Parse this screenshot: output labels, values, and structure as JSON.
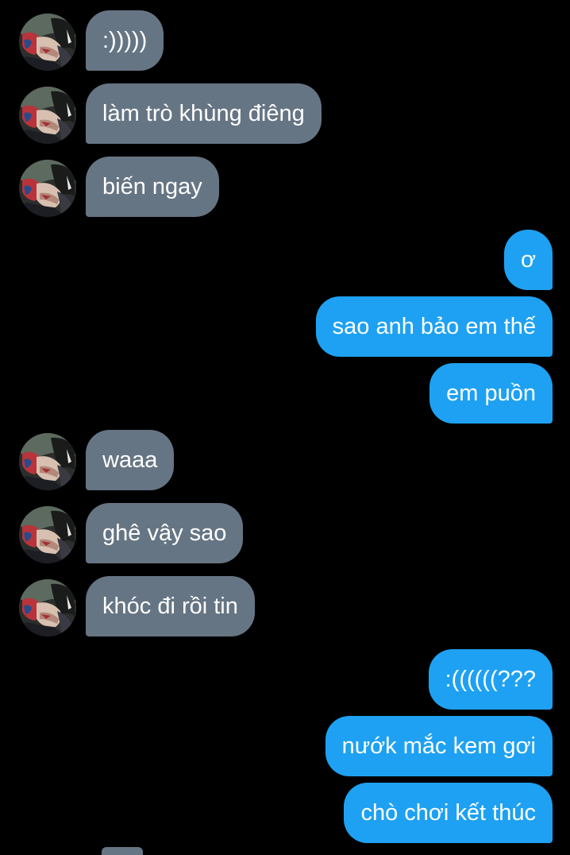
{
  "conversation": {
    "messages": [
      {
        "side": "in",
        "text": ":)))))",
        "avatar": "anime-character-avatar"
      },
      {
        "side": "in",
        "text": "làm trò khùng điêng",
        "avatar": "anime-character-avatar"
      },
      {
        "side": "in",
        "text": "biến ngay",
        "avatar": "anime-character-avatar"
      },
      {
        "side": "out",
        "text": "ơ"
      },
      {
        "side": "out",
        "text": "sao anh bảo em thế"
      },
      {
        "side": "out",
        "text": "em puồn"
      },
      {
        "side": "in",
        "text": "waaa",
        "avatar": "anime-character-avatar"
      },
      {
        "side": "in",
        "text": "ghê vậy sao",
        "avatar": "anime-character-avatar"
      },
      {
        "side": "in",
        "text": "khóc đi rồi tin",
        "avatar": "anime-character-avatar"
      },
      {
        "side": "out",
        "text": ":((((((???"
      },
      {
        "side": "out",
        "text": "nướk mắc kem gơi"
      },
      {
        "side": "out",
        "text": "chò chơi kết thúc"
      }
    ]
  },
  "colors": {
    "background": "#000000",
    "incoming_bubble": "#667584",
    "outgoing_bubble": "#1ea1f2",
    "text": "#ffffff"
  }
}
